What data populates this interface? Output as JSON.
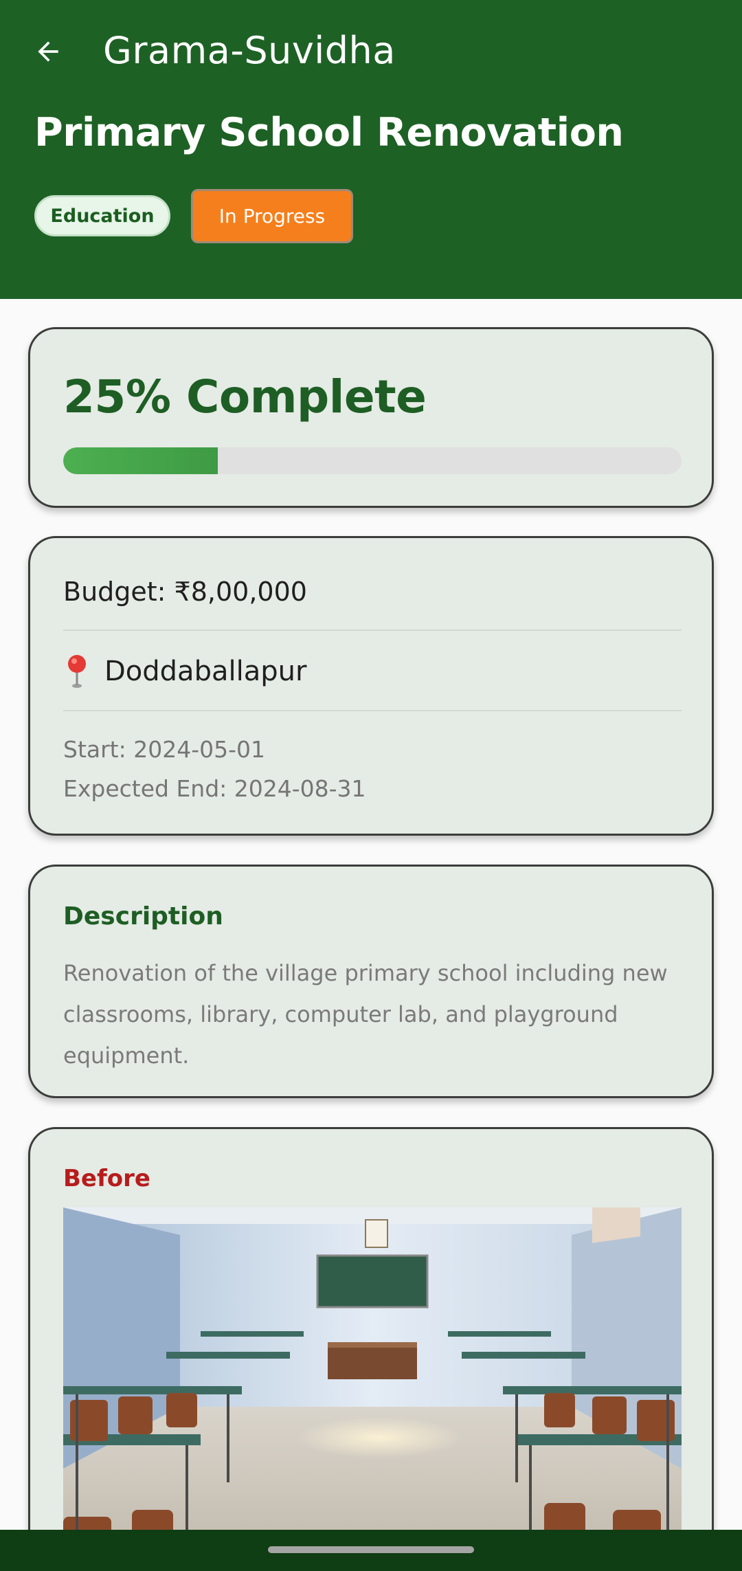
{
  "header": {
    "app_title": "Grama-Suvidha",
    "page_title": "Primary School Renovation",
    "category_chip": "Education",
    "status_chip": "In Progress"
  },
  "progress": {
    "label": "25% Complete",
    "percent": 25
  },
  "details": {
    "budget": "Budget: ₹8,00,000",
    "location": "Doddaballapur",
    "start": "Start: 2024-05-01",
    "expected_end": "Expected End: 2024-08-31"
  },
  "description": {
    "title": "Description",
    "text": "Renovation of the village primary school including new classrooms, library, computer lab, and playground equipment."
  },
  "before": {
    "title": "Before"
  },
  "icons": {
    "back": "arrow-left-icon",
    "location": "map-pin-icon"
  },
  "colors": {
    "header": "#1e6125",
    "status_in_progress": "#f57f1c",
    "progress_fill": "#4caf50",
    "before_label": "#b71c1c"
  }
}
